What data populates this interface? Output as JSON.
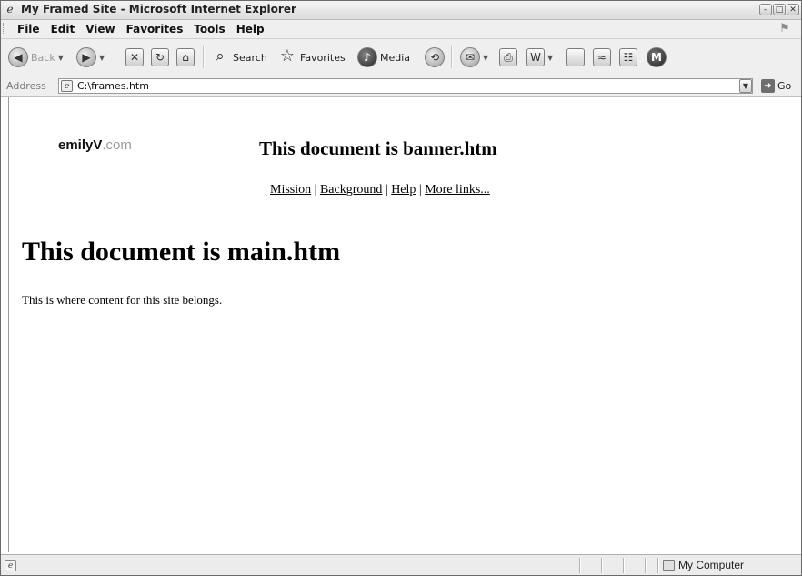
{
  "window": {
    "title": "My Framed Site - Microsoft Internet Explorer",
    "controls": [
      "–",
      "□",
      "✕"
    ]
  },
  "menu": {
    "items": [
      "File",
      "Edit",
      "View",
      "Favorites",
      "Tools",
      "Help"
    ]
  },
  "toolbar": {
    "back_label": "Back",
    "search_label": "Search",
    "favorites_label": "Favorites",
    "media_label": "Media"
  },
  "address": {
    "label": "Address",
    "value": "C:\\frames.htm",
    "go_label": "Go"
  },
  "banner": {
    "logo_name": "emilyV",
    "logo_domain": ".com",
    "title": "This document is banner.htm",
    "links": [
      "Mission",
      "Background",
      "Help",
      "More links..."
    ],
    "separator": "|"
  },
  "main": {
    "title": "This document is main.htm",
    "text": "This is where content for this site belongs."
  },
  "status": {
    "zone": "My Computer"
  },
  "icons": [
    "ie-page-icon",
    "back-icon",
    "forward-icon",
    "stop-icon",
    "refresh-icon",
    "home-icon",
    "search-icon",
    "favorites-icon",
    "media-icon",
    "history-icon",
    "mail-icon",
    "print-icon",
    "edit-icon",
    "discuss-icon",
    "research-icon",
    "messenger-icon",
    "windows-flag-icon",
    "go-icon",
    "computer-icon"
  ]
}
